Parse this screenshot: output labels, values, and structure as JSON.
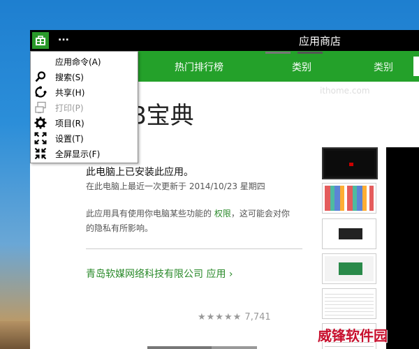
{
  "window": {
    "title": "应用商店"
  },
  "titlebar": {
    "ellipsis": "..."
  },
  "nav": {
    "hot": "热门排行榜",
    "category": "类别",
    "category_dup": "类别"
  },
  "watermark_text": "ithome.com",
  "app": {
    "title_visible": "8宝典",
    "installed": "此电脑上已安装此应用。",
    "updated": "在此电脑上最近一次更新于 2014/10/23 星期四",
    "perm_prefix": "此应用具有使用你电脑某些功能的 ",
    "perm_link": "权限",
    "perm_suffix": "，这可能会对你",
    "perm_line2": "的隐私有所影响。",
    "publisher": "青岛软媒网络科技有限公司 应用 ›",
    "rating_stars": "★★★★★",
    "rating_count": "7,741"
  },
  "menu": {
    "items": [
      {
        "label": "应用命令(A)",
        "icon": "none",
        "enabled": true
      },
      {
        "label": "搜索(S)",
        "icon": "search-icon",
        "enabled": true
      },
      {
        "label": "共享(H)",
        "icon": "share-icon",
        "enabled": true
      },
      {
        "label": "打印(P)",
        "icon": "print-icon",
        "enabled": false
      },
      {
        "label": "项目(R)",
        "icon": "devices-icon",
        "enabled": true
      },
      {
        "label": "设置(T)",
        "icon": "settings-icon",
        "enabled": true
      },
      {
        "label": "全屏显示(F)",
        "icon": "fullscreen-icon",
        "enabled": true
      }
    ]
  },
  "brand_watermark": "威锋软件园",
  "colors": {
    "store_green": "#24a12a",
    "titlebar": "#000000",
    "accent_text": "#2a8a2a"
  }
}
